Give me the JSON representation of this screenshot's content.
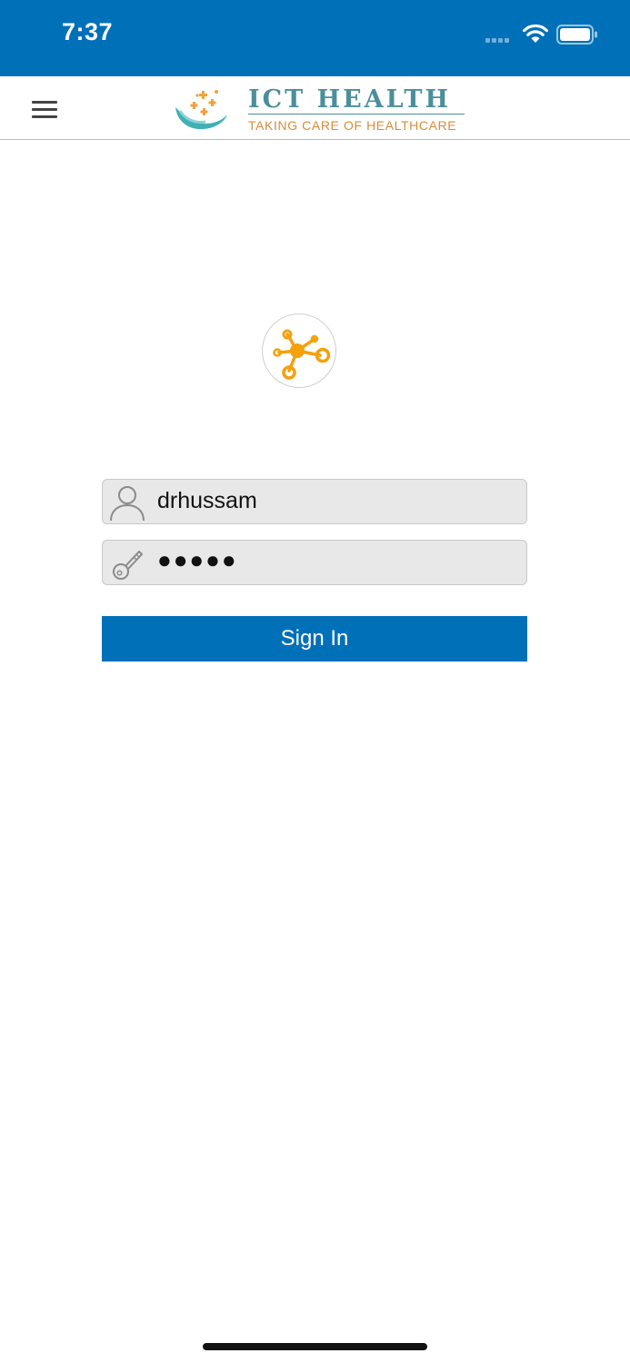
{
  "status_bar": {
    "time": "7:37",
    "background_color": "#0070b8",
    "icons": [
      "signal-dots-icon",
      "wifi-icon",
      "battery-icon"
    ]
  },
  "nav": {
    "menu_icon": "hamburger-menu-icon",
    "brand_title": "ICT HEALTH",
    "brand_tagline": "TAKING CARE OF HEALTHCARE",
    "brand_title_color": "#4a8f9b",
    "brand_tagline_color": "#d88c3a"
  },
  "app_logo": {
    "icon": "network-nodes-icon",
    "color": "#f5a00c"
  },
  "login_form": {
    "username": {
      "icon": "user-icon",
      "value": "drhussam"
    },
    "password": {
      "icon": "key-icon",
      "masked_value": "●●●●●"
    },
    "submit_label": "Sign In",
    "submit_color": "#0070b8"
  }
}
